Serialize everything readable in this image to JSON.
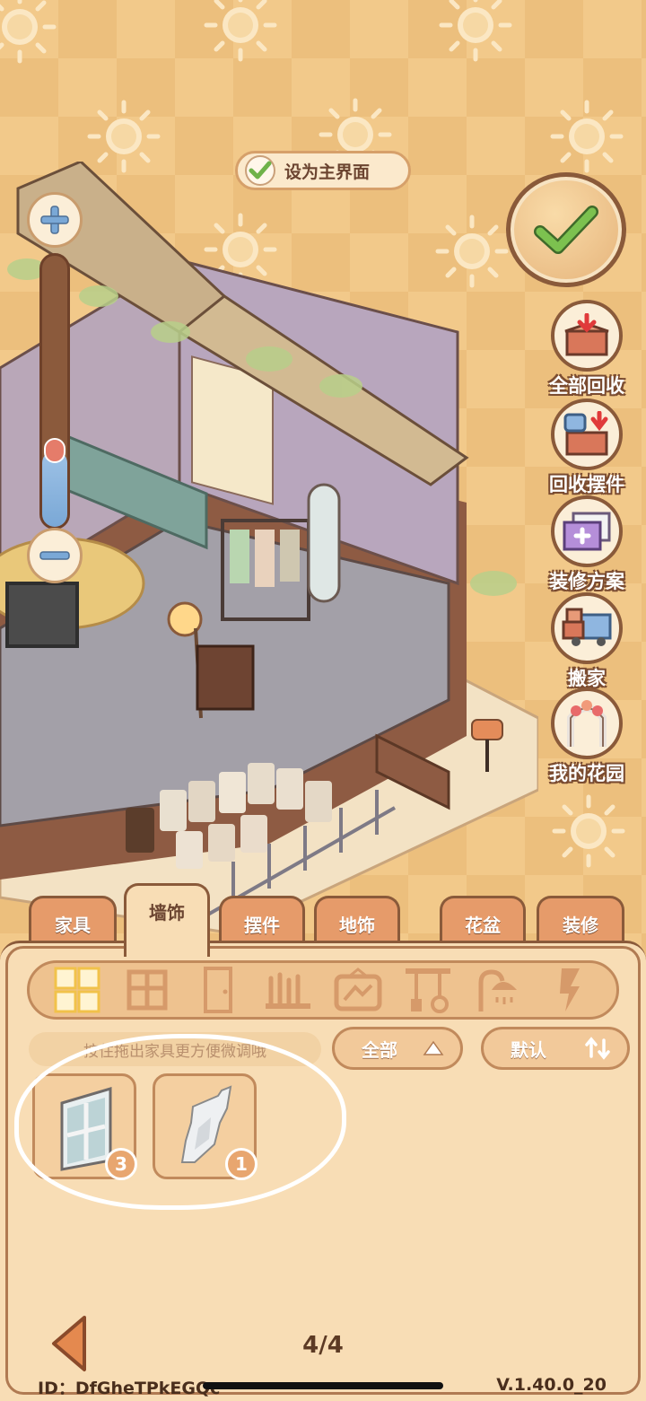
{
  "top": {
    "set_main_label": "设为主界面",
    "set_main_checked": true
  },
  "side_buttons": [
    {
      "label": "全部回收",
      "icon": "recycle-box-icon"
    },
    {
      "label": "回收摆件",
      "icon": "recycle-ornament-icon"
    },
    {
      "label": "装修方案",
      "icon": "decor-plan-icon"
    },
    {
      "label": "搬家",
      "icon": "moving-truck-icon"
    },
    {
      "label": "我的花园",
      "icon": "garden-arch-icon"
    }
  ],
  "zoom": {
    "level": 0.28
  },
  "tabs": [
    {
      "label": "家具",
      "active": false
    },
    {
      "label": "墙饰",
      "active": true
    },
    {
      "label": "摆件",
      "active": false
    },
    {
      "label": "地饰",
      "active": false
    },
    {
      "label": "花盆",
      "active": false
    },
    {
      "label": "装修",
      "active": false
    }
  ],
  "categories": [
    "all-grid-icon",
    "window-icon",
    "door-icon",
    "fence-icon",
    "wall-picture-icon",
    "hanging-tools-icon",
    "shower-icon",
    "wall-lamp-icon"
  ],
  "hint_text": "按住拖出家具更方便微调哦",
  "filter": {
    "scope_label": "全部",
    "sort_label": "默认"
  },
  "items": [
    {
      "name": "window",
      "count": "3"
    },
    {
      "name": "wall-sticker",
      "count": "1"
    }
  ],
  "page": "4/4",
  "footer": {
    "id": "ID：DfGheTPkEGQc",
    "version": "V.1.40.0_20"
  },
  "colors": {
    "accent": "#e69b6a",
    "panel": "#f8ddb5",
    "outline": "#8a5a3a",
    "check": "#6fb24a"
  }
}
